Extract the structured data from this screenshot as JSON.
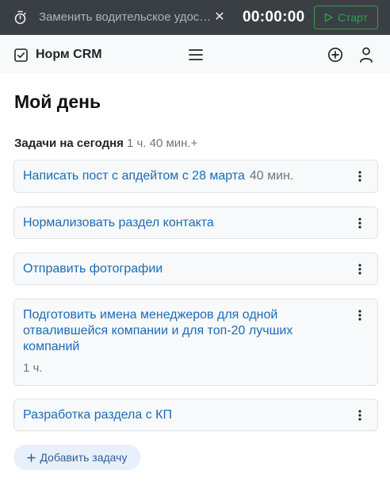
{
  "timer": {
    "task": "Заменить водительское удостоверение",
    "clear_symbol": "✕",
    "time": "00:00:00",
    "start_label": "Старт"
  },
  "navbar": {
    "brand": "Норм CRM"
  },
  "page": {
    "title": "Мой день"
  },
  "section": {
    "label": "Задачи на сегодня",
    "total": "1 ч. 40 мин.+"
  },
  "tasks": [
    {
      "title": "Написать пост с апдейтом с 28 марта",
      "duration": "40 мин."
    },
    {
      "title": "Нормализовать раздел контакта"
    },
    {
      "title": "Отправить фотографии"
    },
    {
      "title": "Подготовить имена менеджеров для одной отвалившейся компании и для топ-20 лучших компаний",
      "duration": "1 ч."
    },
    {
      "title": "Разработка раздела с КП"
    }
  ],
  "add_task": {
    "label": "Добавить задачу"
  },
  "colors": {
    "timer_bg": "#3a3f44",
    "start_green": "#2aa24a",
    "link_blue": "#1a6bb8",
    "navbar_bg": "#f8f9fa",
    "card_bg": "#f8f9fa"
  },
  "icons": {
    "timer": "stopwatch-icon",
    "clear": "close-icon",
    "start": "play-icon",
    "brand": "check-square-icon",
    "menu": "hamburger-icon",
    "add": "plus-circle-icon",
    "user": "person-icon",
    "task_menu": "kebab-icon",
    "add_task": "plus-icon"
  }
}
